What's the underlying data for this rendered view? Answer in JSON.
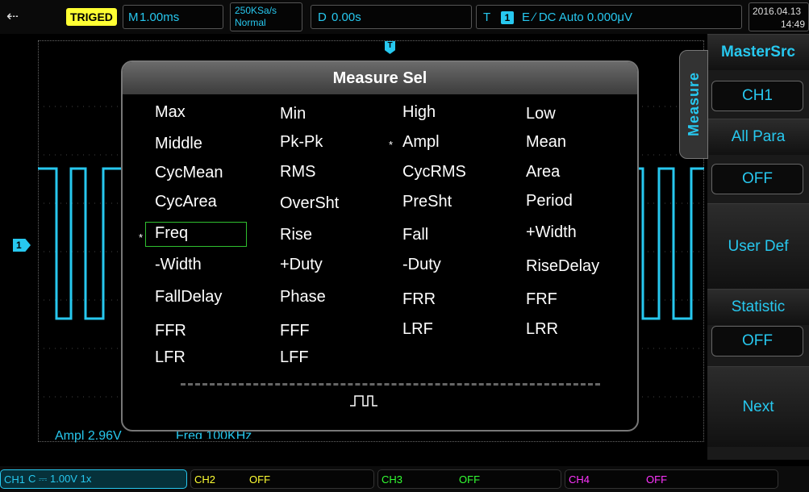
{
  "top_bar": {
    "usb_icon": "usb-icon",
    "trigger_status": "TRIGED",
    "timebase_label": "M",
    "timebase_value": "1.00ms",
    "sample_rate": "250KSa/s",
    "acq_mode": "Normal",
    "delay_label": "D",
    "delay_value": "0.00s",
    "trigger_label": "T",
    "trigger_channel": "1",
    "trigger_info": "E ∕ DC Auto 0.000μV",
    "date": "2016.04.13",
    "time": "14:49"
  },
  "channel_marker": "1",
  "trigger_marker": "T",
  "measurement_readouts": {
    "ampl": "Ampl 2.96V",
    "freq": "Freq 100KHz"
  },
  "dialog": {
    "title": "Measure Sel",
    "options": [
      [
        "Max",
        "Min",
        "High",
        "Low"
      ],
      [
        "Middle",
        "Pk-Pk",
        "Ampl",
        "Mean"
      ],
      [
        "CycMean",
        "RMS",
        "CycRMS",
        "Area"
      ],
      [
        "CycArea",
        "OverSht",
        "PreSht",
        "Period"
      ],
      [
        "Freq",
        "Rise",
        "Fall",
        "+Width"
      ],
      [
        "-Width",
        "+Duty",
        "-Duty",
        "RiseDelay"
      ],
      [
        "FallDelay",
        "Phase",
        "FRR",
        "FRF"
      ],
      [
        "FFR",
        "FFF",
        "LRF",
        "LRR"
      ],
      [
        "LFR",
        "LFF"
      ]
    ],
    "selected_marker": "*",
    "selected": [
      "Ampl",
      "Freq"
    ],
    "highlighted": "Freq",
    "preview_icon": "pulse-waveform-icon"
  },
  "side_menu": {
    "tab_label": "Measure",
    "mastersrc_label": "MasterSrc",
    "mastersrc_value": "CH1",
    "allpara_label": "All Para",
    "allpara_value": "OFF",
    "userdef_label": "User Def",
    "statistic_label": "Statistic",
    "statistic_value": "OFF",
    "next_label": "Next"
  },
  "bottom_bar": {
    "ch1": {
      "name": "CH1",
      "settings": "C ⎓ 1.00V 1x",
      "color": "#27c8ef"
    },
    "ch2": {
      "name": "CH2",
      "settings": "OFF",
      "color": "#ffff33"
    },
    "ch3": {
      "name": "CH3",
      "settings": "OFF",
      "color": "#33ff33"
    },
    "ch4": {
      "name": "CH4",
      "settings": "OFF",
      "color": "#ff33ff"
    }
  }
}
